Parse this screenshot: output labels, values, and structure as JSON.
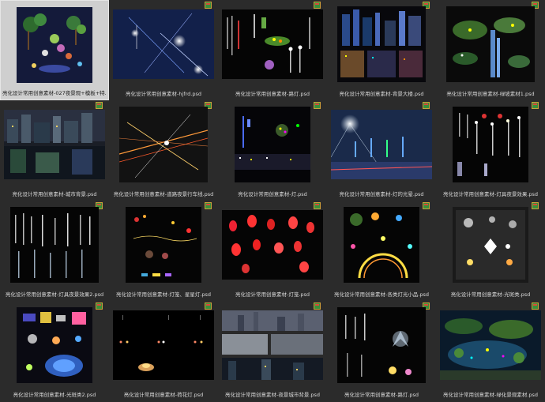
{
  "files": [
    {
      "name": "亮化设计常用创意素材-027夜景观+模板+特..."
    },
    {
      "name": "亮化设计常用创意素材-hjfrd.psd"
    },
    {
      "name": "亮化设计常用创意素材-路灯.psd"
    },
    {
      "name": "亮化设计常用创意素材-背景大楼.psd"
    },
    {
      "name": "亮化设计常用创意素材-绿坡素材1.psd"
    },
    {
      "name": "亮化设计常用创意素材-城市背景.psd"
    },
    {
      "name": "亮化设计常用创意素材-道路夜景行车线.psd"
    },
    {
      "name": "亮化设计常用创意素材-灯.psd"
    },
    {
      "name": "亮化设计常用创意素材-灯的光晕.psd"
    },
    {
      "name": "亮化设计常用创意素材-灯具夜景效果.psd"
    },
    {
      "name": "亮化设计常用创意素材-灯具夜景效果2.psd"
    },
    {
      "name": "亮化设计常用创意素材-灯笼、星星灯.psd"
    },
    {
      "name": "亮化设计常用创意素材-灯笼.psd"
    },
    {
      "name": "亮化设计常用创意素材-各类灯光小品.psd"
    },
    {
      "name": "亮化设计常用创意素材-光斑类.psd"
    },
    {
      "name": "亮化设计常用创意素材-光斑类2.psd"
    },
    {
      "name": "亮化设计常用创意素材-荷花灯.psd"
    },
    {
      "name": "亮化设计常用创意素材-夜景城市背景.psd"
    },
    {
      "name": "亮化设计常用创意素材-路灯.psd"
    },
    {
      "name": "亮化设计常用创意素材-绿化景观素材.psd"
    }
  ],
  "colors": {
    "background": "#2b2b2b",
    "selected": "#cfcfcf",
    "caption": "#d8d8d8"
  }
}
